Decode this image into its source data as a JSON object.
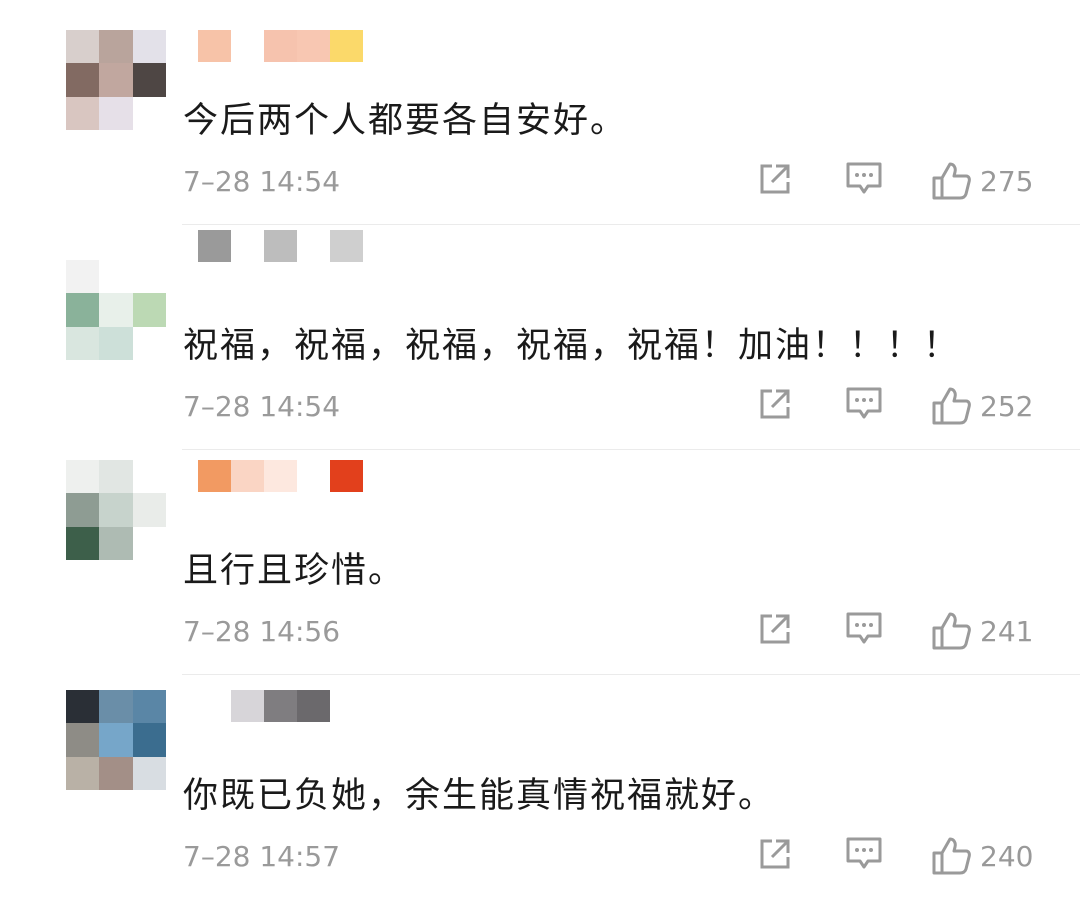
{
  "comments": [
    {
      "text": "今后两个人都要各自安好。",
      "time": "7–28 14:54",
      "likes": "275",
      "avatar_colors": [
        "#d8cfcc",
        "#b9a49c",
        "#e3e1e9",
        "#826a62",
        "#c1a79f",
        "#4e4644",
        "#d9c6c1",
        "#e6e0e8",
        "#ffffff"
      ],
      "name_colors": [
        "#f7c3a8",
        "#ffffff",
        "#f6c3ae",
        "#f8c7b2",
        "#fbd96a"
      ]
    },
    {
      "text": "祝福，祝福，祝福，祝福，祝福！加油！！！！",
      "time": "7–28 14:54",
      "likes": "252",
      "avatar_colors": [
        "#f2f2f2",
        "#ffffff",
        "#ffffff",
        "#8ab29a",
        "#e8f0ea",
        "#bcd9b4",
        "#d9e6df",
        "#cde0d9",
        "#ffffff"
      ],
      "name_colors": [
        "#9a9a9a",
        "#ffffff",
        "#bdbdbd",
        "#ffffff",
        "#cfcfcf"
      ]
    },
    {
      "text": "且行且珍惜。",
      "time": "7–28 14:56",
      "likes": "241",
      "avatar_colors": [
        "#eef0ee",
        "#e1e6e3",
        "#ffffff",
        "#8e9c93",
        "#c7d3cc",
        "#e9ece9",
        "#3d5f4a",
        "#aebbb3",
        "#ffffff"
      ],
      "name_colors": [
        "#f29a62",
        "#fad5c4",
        "#fde8df",
        "#ffffff",
        "#e2401c"
      ]
    },
    {
      "text": "你既已负她，余生能真情祝福就好。",
      "time": "7–28 14:57",
      "likes": "240",
      "avatar_colors": [
        "#2a2f36",
        "#6a8ea8",
        "#5a86a6",
        "#8e8c86",
        "#76a6c9",
        "#3b6d8f",
        "#b9b1a6",
        "#a38f87",
        "#d8dde2"
      ],
      "name_colors": [
        "#ffffff",
        "#d7d5d9",
        "#7f7d80",
        "#6b696c",
        "#ffffff"
      ]
    }
  ],
  "icons": {
    "share": "share-icon",
    "comment": "comment-icon",
    "like": "thumbs-up-icon"
  }
}
